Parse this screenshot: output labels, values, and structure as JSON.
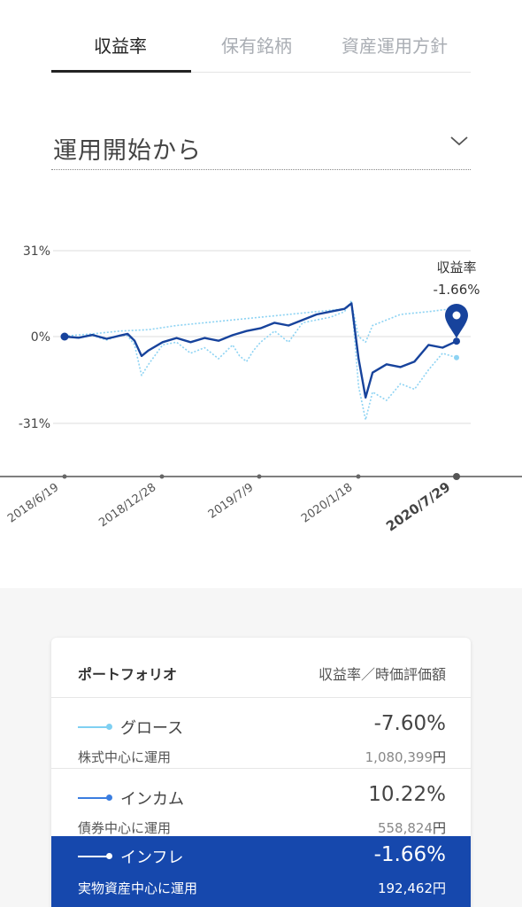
{
  "tabs": [
    {
      "label": "収益率",
      "active": true
    },
    {
      "label": "保有銘柄",
      "active": false
    },
    {
      "label": "資産運用方針",
      "active": false
    }
  ],
  "period": {
    "selected": "運用開始から",
    "icon": "chevron-down-icon"
  },
  "chart_data": {
    "type": "line",
    "y_ticks": [
      "31%",
      "0%",
      "-31%"
    ],
    "ylim": [
      -50,
      31
    ],
    "x_ticks": [
      "2018/6/19",
      "2018/12/28",
      "2019/7/9",
      "2020/1/18",
      "2020/7/29"
    ],
    "current_label": "収益率",
    "current_value": "-1.66%",
    "series": [
      {
        "name": "グロース",
        "color": "#8dd3f3",
        "style": "dotted",
        "values": [
          [
            0,
            0
          ],
          [
            10,
            -0.5
          ],
          [
            20,
            0.4
          ],
          [
            30,
            -1.2
          ],
          [
            40,
            0.5
          ],
          [
            45,
            0.3
          ],
          [
            50,
            -3
          ],
          [
            55,
            -14
          ],
          [
            60,
            -10
          ],
          [
            70,
            -3
          ],
          [
            80,
            -2
          ],
          [
            90,
            -6
          ],
          [
            100,
            -4
          ],
          [
            110,
            -8
          ],
          [
            120,
            -3
          ],
          [
            125,
            -7
          ],
          [
            130,
            -9
          ],
          [
            135,
            -5
          ],
          [
            140,
            -2
          ],
          [
            150,
            2
          ],
          [
            160,
            -2
          ],
          [
            170,
            5
          ],
          [
            180,
            6
          ],
          [
            190,
            7
          ],
          [
            200,
            9
          ],
          [
            205,
            13
          ],
          [
            210,
            -18
          ],
          [
            215,
            -30
          ],
          [
            220,
            -20
          ],
          [
            230,
            -23
          ],
          [
            240,
            -17
          ],
          [
            250,
            -19
          ],
          [
            260,
            -12
          ],
          [
            270,
            -6
          ],
          [
            280,
            -7.6
          ]
        ]
      },
      {
        "name": "インカム",
        "color": "#8dd3f3",
        "style": "dotted",
        "values": [
          [
            0,
            0.2
          ],
          [
            20,
            1
          ],
          [
            40,
            2
          ],
          [
            60,
            2.5
          ],
          [
            80,
            4
          ],
          [
            100,
            5
          ],
          [
            120,
            6
          ],
          [
            140,
            7
          ],
          [
            160,
            8
          ],
          [
            180,
            9
          ],
          [
            200,
            10
          ],
          [
            205,
            12
          ],
          [
            210,
            0
          ],
          [
            215,
            -2
          ],
          [
            220,
            4
          ],
          [
            230,
            6
          ],
          [
            240,
            8
          ],
          [
            260,
            9
          ],
          [
            280,
            10.22
          ]
        ]
      },
      {
        "name": "インフレ",
        "color": "#17439c",
        "style": "solid",
        "values": [
          [
            0,
            0
          ],
          [
            10,
            -0.4
          ],
          [
            20,
            0.6
          ],
          [
            30,
            -0.8
          ],
          [
            40,
            0.4
          ],
          [
            45,
            1
          ],
          [
            50,
            -1.5
          ],
          [
            55,
            -7
          ],
          [
            60,
            -5
          ],
          [
            70,
            -2
          ],
          [
            80,
            -0.5
          ],
          [
            90,
            -2
          ],
          [
            100,
            -0.5
          ],
          [
            110,
            -1.5
          ],
          [
            120,
            0.5
          ],
          [
            130,
            2
          ],
          [
            140,
            3
          ],
          [
            150,
            5
          ],
          [
            160,
            4
          ],
          [
            170,
            6
          ],
          [
            180,
            8
          ],
          [
            190,
            9
          ],
          [
            200,
            10
          ],
          [
            205,
            12
          ],
          [
            210,
            -8
          ],
          [
            215,
            -22
          ],
          [
            220,
            -13
          ],
          [
            230,
            -10
          ],
          [
            240,
            -11
          ],
          [
            250,
            -9
          ],
          [
            260,
            -3
          ],
          [
            270,
            -4
          ],
          [
            280,
            -1.66
          ]
        ]
      }
    ]
  },
  "portfolio": {
    "header_left": "ポートフォリオ",
    "header_right": "収益率／時価評価額",
    "rows": [
      {
        "name": "グロース",
        "pct": "-7.60%",
        "desc": "株式中心に運用",
        "value": "1,080,399",
        "yen": "円",
        "color": "#7fd0f2"
      },
      {
        "name": "インカム",
        "pct": "10.22%",
        "desc": "債券中心に運用",
        "value": "558,824",
        "yen": "円",
        "color": "#3a7de0"
      },
      {
        "name": "インフレ",
        "pct": "-1.66%",
        "desc": "実物資産中心に運用",
        "value": "192,462",
        "yen": "円",
        "color": "#ffffff"
      }
    ]
  }
}
